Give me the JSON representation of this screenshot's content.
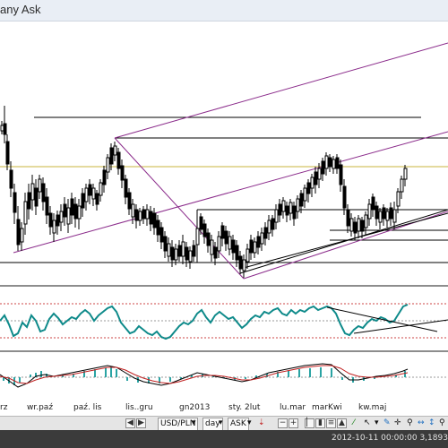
{
  "window": {
    "title": "any Ask"
  },
  "axis": {
    "labels": [
      "rz",
      "wr.paź",
      "paź. lis",
      "lis..gru",
      "gn2013",
      "sty. 2lut",
      "lu.mar",
      "marKwi",
      "kw.maj"
    ]
  },
  "toolbar": {
    "symbol": "USD/PLN",
    "timeframe": "day",
    "price_type": "ASK"
  },
  "status": {
    "text": "2012-10-11 00:00:00  3,1893[0"
  },
  "colors": {
    "price": "#000000",
    "channel": "#8b2c8b",
    "level": "#c8b43c",
    "oscillator": "#0e8a8a",
    "macd_hist": "#2aa3a3",
    "macd_line": "#000000",
    "signal_line": "#c02020",
    "statusbar": "#3b3b3b"
  },
  "chart_data": {
    "type": "candlestick",
    "series": []
  }
}
